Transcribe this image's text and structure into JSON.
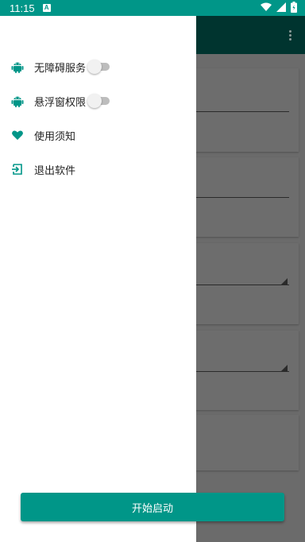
{
  "status_bar": {
    "time": "11:15",
    "notification_icon": "a-notification-icon",
    "icons": [
      "wifi-icon",
      "signal-icon",
      "battery-icon"
    ]
  },
  "app_bar": {
    "overflow_icon": "overflow-menu-icon"
  },
  "drawer": {
    "items": [
      {
        "label": "无障碍服务",
        "icon": "android-icon",
        "has_switch": true,
        "switch_on": false
      },
      {
        "label": "悬浮窗权限",
        "icon": "android-icon",
        "has_switch": true,
        "switch_on": false
      },
      {
        "label": "使用须知",
        "icon": "heart-icon",
        "has_switch": false
      },
      {
        "label": "退出软件",
        "icon": "exit-icon",
        "has_switch": false
      }
    ]
  },
  "start_button": {
    "label": "开始启动"
  },
  "colors": {
    "accent": "#009688",
    "app_bar_dimmed": "#00342f",
    "scrim_background": "#6b6b6b"
  }
}
